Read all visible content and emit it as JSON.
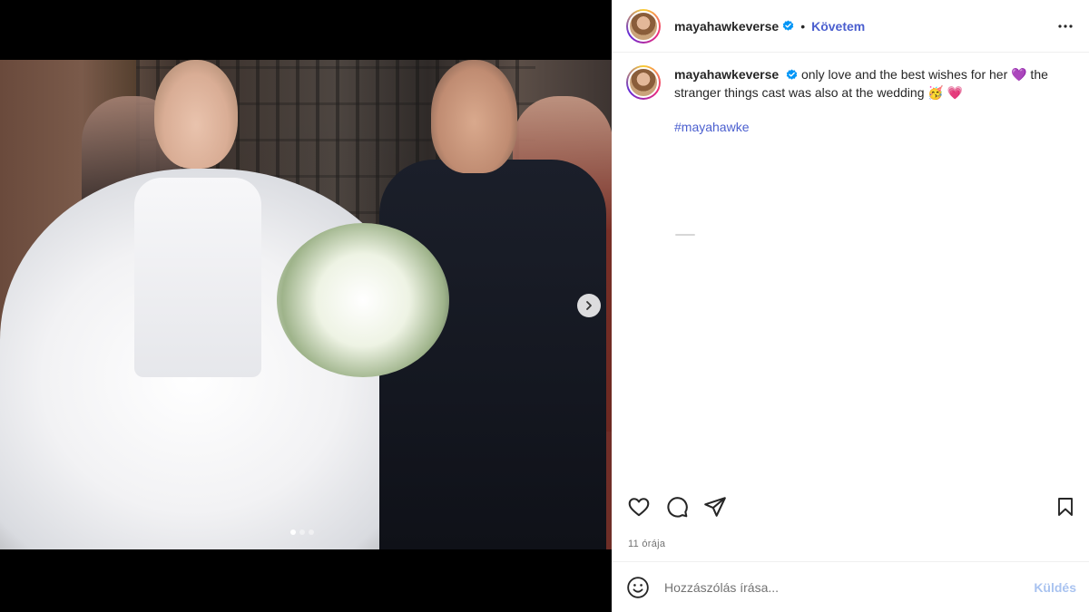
{
  "post": {
    "username": "mayahawkeverse",
    "verified": true,
    "separator": "•",
    "follow_label": "Követem",
    "caption": {
      "username": "mayahawkeverse",
      "text_part1": "only love and the best wishes for her 💜 the stranger things cast was also at the wedding 🥳 💗",
      "hashtag": "#mayahawke"
    },
    "timestamp": "11 órája",
    "carousel": {
      "total": 3,
      "current": 1
    }
  },
  "comment": {
    "placeholder": "Hozzászólás írása...",
    "send_label": "Küldés"
  },
  "icons": {
    "more": "more-horizontal-icon",
    "like": "heart-icon",
    "comment": "comment-bubble-icon",
    "share": "paper-plane-icon",
    "save": "bookmark-icon",
    "emoji": "smiley-icon",
    "next": "chevron-right-icon",
    "verified": "verified-badge-icon"
  },
  "colors": {
    "verified": "#0095f6",
    "link": "#4b5fcf",
    "send_disabled": "#a9c3f0"
  }
}
